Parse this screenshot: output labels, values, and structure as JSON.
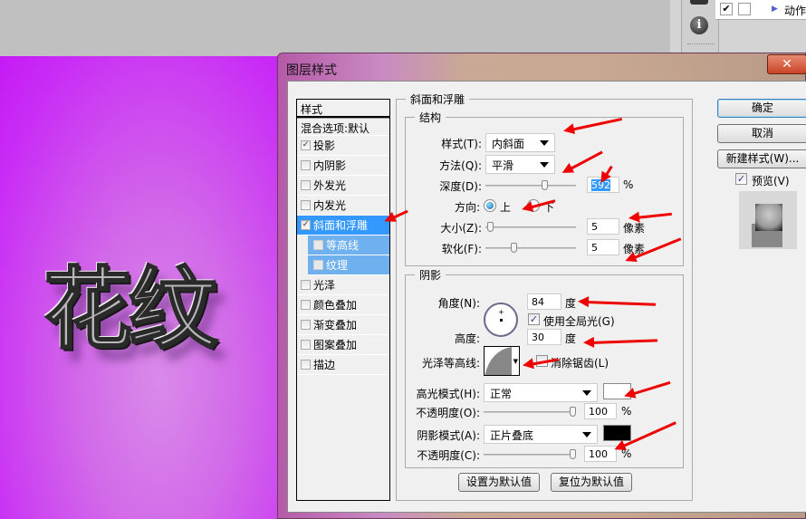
{
  "canvas": {
    "text": "花纹",
    "background_color": "#c92ef5"
  },
  "panel": {
    "info_icon": "i",
    "check": "✔",
    "action_label": "动作"
  },
  "dialog": {
    "title": "图层样式",
    "close": "✕",
    "style_list": {
      "header": "样式",
      "blend": "混合选项:默认",
      "items": [
        {
          "label": "投影",
          "checked": true,
          "selected": false,
          "sub": false
        },
        {
          "label": "内阴影",
          "checked": false,
          "selected": false,
          "sub": false
        },
        {
          "label": "外发光",
          "checked": false,
          "selected": false,
          "sub": false
        },
        {
          "label": "内发光",
          "checked": false,
          "selected": false,
          "sub": false
        },
        {
          "label": "斜面和浮雕",
          "checked": true,
          "selected": true,
          "sub": false
        },
        {
          "label": "等高线",
          "checked": false,
          "selected": false,
          "sub": true
        },
        {
          "label": "纹理",
          "checked": false,
          "selected": false,
          "sub": true
        },
        {
          "label": "光泽",
          "checked": false,
          "selected": false,
          "sub": false
        },
        {
          "label": "颜色叠加",
          "checked": false,
          "selected": false,
          "sub": false
        },
        {
          "label": "渐变叠加",
          "checked": false,
          "selected": false,
          "sub": false
        },
        {
          "label": "图案叠加",
          "checked": false,
          "selected": false,
          "sub": false
        },
        {
          "label": "描边",
          "checked": false,
          "selected": false,
          "sub": false
        }
      ]
    },
    "bevel": {
      "title": "斜面和浮雕",
      "structure": {
        "title": "结构",
        "style_label": "样式(T):",
        "style_value": "内斜面",
        "technique_label": "方法(Q):",
        "technique_value": "平滑",
        "depth_label": "深度(D):",
        "depth_value": "592",
        "depth_unit": "%",
        "direction_label": "方向:",
        "direction_up": "上",
        "direction_down": "下",
        "direction_selected": "上",
        "size_label": "大小(Z):",
        "size_value": "5",
        "size_unit": "像素",
        "soften_label": "软化(F):",
        "soften_value": "5",
        "soften_unit": "像素"
      },
      "shading": {
        "title": "阴影",
        "angle_label": "角度(N):",
        "angle_value": "84",
        "angle_unit": "度",
        "global_light_label": "使用全局光(G)",
        "global_light_checked": true,
        "altitude_label": "高度:",
        "altitude_value": "30",
        "altitude_unit": "度",
        "gloss_label": "光泽等高线:",
        "antialias_label": "消除锯齿(L)",
        "antialias_checked": false,
        "highlight_mode_label": "高光模式(H):",
        "highlight_mode_value": "正常",
        "highlight_color": "#ffffff",
        "highlight_opacity_label": "不透明度(O):",
        "highlight_opacity_value": "100",
        "highlight_opacity_unit": "%",
        "shadow_mode_label": "阴影模式(A):",
        "shadow_mode_value": "正片叠底",
        "shadow_color": "#000000",
        "shadow_opacity_label": "不透明度(C):",
        "shadow_opacity_value": "100",
        "shadow_opacity_unit": "%"
      },
      "make_default": "设置为默认值",
      "reset_default": "复位为默认值"
    },
    "buttons": {
      "ok": "确定",
      "cancel": "取消",
      "new_style": "新建样式(W)...",
      "preview_label": "预览(V)",
      "preview_checked": true
    }
  }
}
